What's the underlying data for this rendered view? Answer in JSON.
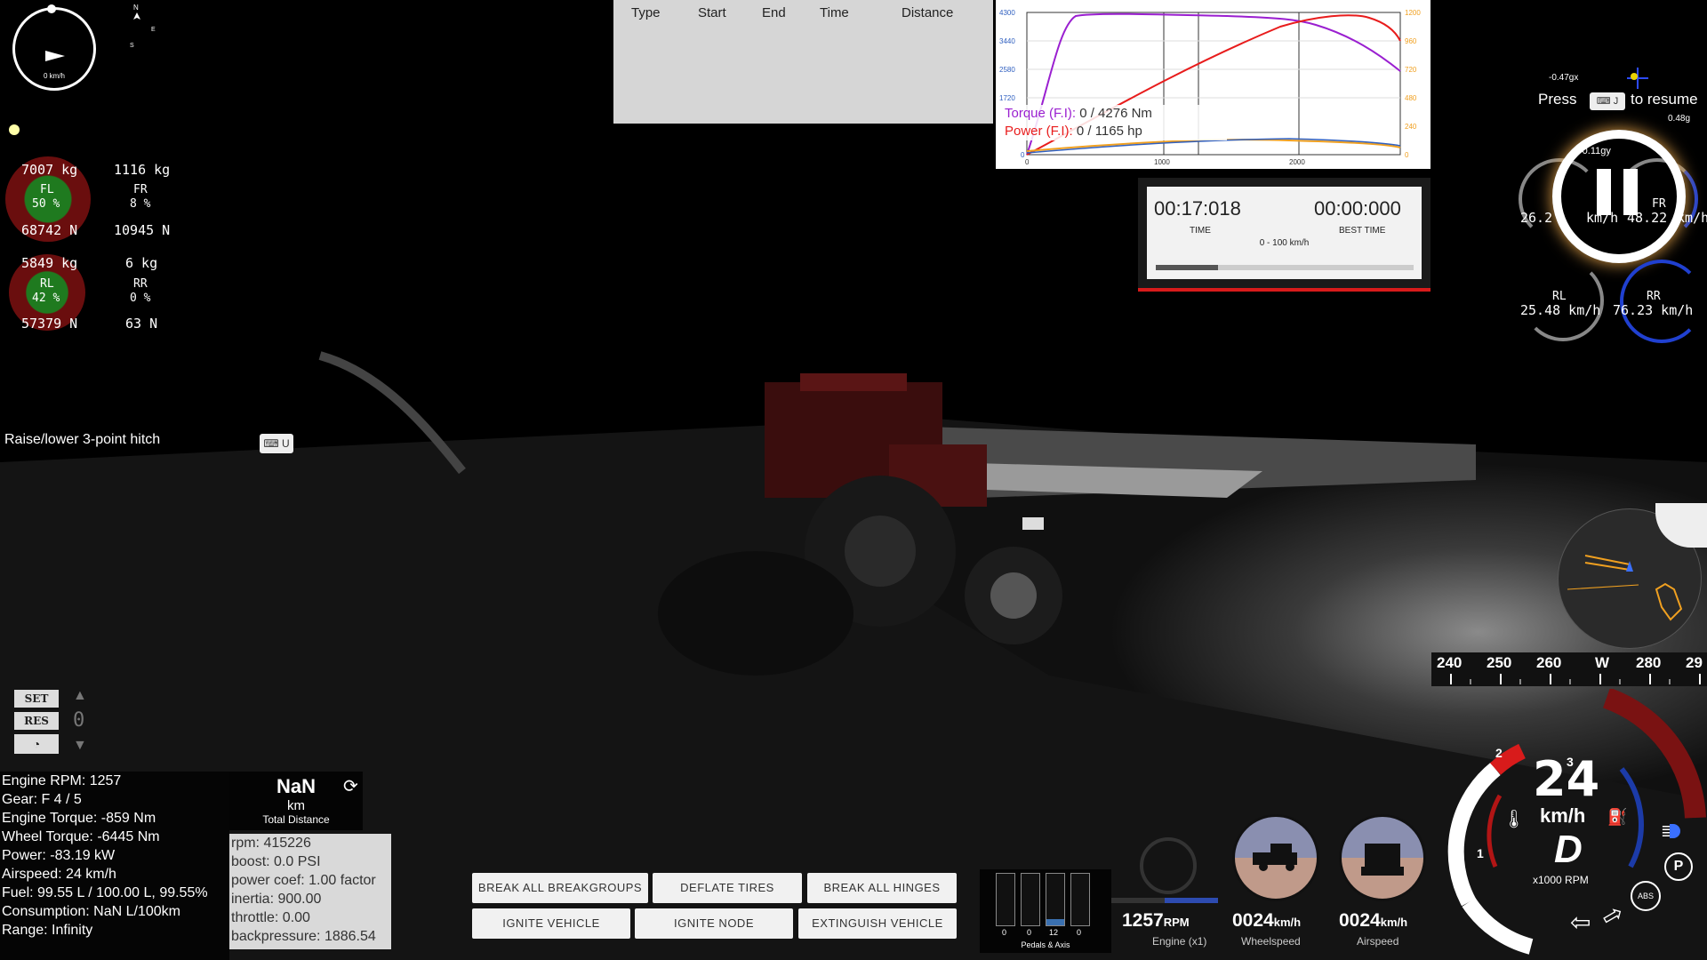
{
  "compass": {
    "speed_text": "0 km/h",
    "small_n": "N",
    "small_s": "S",
    "small_e": "E"
  },
  "wheels": {
    "fl": {
      "weight": "7007 kg",
      "name": "FL",
      "pct": "50 %",
      "force": "68742 N"
    },
    "fr": {
      "weight": "1116 kg",
      "name": "FR",
      "pct": "8 %",
      "force": "10945 N"
    },
    "rl": {
      "weight": "5849 kg",
      "name": "RL",
      "pct": "42 %",
      "force": "57379 N"
    },
    "rr": {
      "weight": "6 kg",
      "name": "RR",
      "pct": "0 %",
      "force": "63 N"
    }
  },
  "hint": {
    "label": "Raise/lower 3-point hitch",
    "key": "U"
  },
  "drag_table": {
    "headers": [
      "Type",
      "Start",
      "End",
      "Time",
      "Distance"
    ]
  },
  "torque_graph": {
    "left_ticks": [
      "4300",
      "3440",
      "2580",
      "1720",
      "0"
    ],
    "right_ticks": [
      "1200",
      "960",
      "720",
      "480",
      "240",
      "0"
    ],
    "x_ticks": [
      "0",
      "1000",
      "2000"
    ],
    "torque_label": "Torque (F.I):",
    "torque_value": "0 / 4276 Nm",
    "power_label": "Power (F.I):",
    "power_value": "0 / 1165 hp",
    "colors": {
      "torque": "#9a1fd0",
      "power": "#e81c1c",
      "blue": "#3060c0",
      "orange": "#f0a020"
    }
  },
  "timer": {
    "time": "00:17:018",
    "time_label": "TIME",
    "best": "00:00:000",
    "best_label": "BEST TIME",
    "mode": "0 - 100 km/h",
    "progress": 0.24
  },
  "pause": {
    "press": "Press",
    "key": "J",
    "resume": "to resume",
    "gx": "-0.47gx",
    "gy": "0.48g",
    "gy2": "-0.11gy"
  },
  "wheel_speeds": {
    "fl": "26.2",
    "fl_unit": "km/h",
    "fr_label": "FR",
    "fr": "48.22",
    "fr_unit": "km/h",
    "rl_label": "RL",
    "rl": "25.48 km/h",
    "rr_label": "RR",
    "rr": "76.23 km/h"
  },
  "cruise": {
    "set": "SET",
    "res": "RES",
    "digit": "0"
  },
  "stats": {
    "rpm": "Engine RPM: 1257",
    "gear": "Gear: F 4 / 5",
    "eng_torque": "Engine Torque: -859 Nm",
    "wheel_torque": "Wheel Torque: -6445 Nm",
    "power": "Power: -83.19 kW",
    "airspeed": "Airspeed: 24 km/h",
    "fuel": "Fuel: 99.55 L / 100.00 L, 99.55%",
    "consumption": "Consumption: NaN L/100km",
    "range": "Range: Infinity"
  },
  "trip": {
    "value": "NaN",
    "unit": "km",
    "label": "Total Distance"
  },
  "engine_panel": {
    "rpm": "rpm: 415226",
    "boost": "boost: 0.0 PSI",
    "power_coef": "power coef: 1.00 factor",
    "inertia": "inertia: 900.00",
    "throttle": "throttle: 0.00",
    "backpressure": "backpressure: 1886.54"
  },
  "buttons": {
    "break_groups": "BREAK ALL BREAKGROUPS",
    "deflate": "DEFLATE TIRES",
    "break_hinges": "BREAK ALL HINGES",
    "ignite_vehicle": "IGNITE VEHICLE",
    "ignite_node": "IGNITE NODE",
    "extinguish": "EXTINGUISH VEHICLE"
  },
  "pedals": {
    "values": [
      "0",
      "0",
      "12",
      "0"
    ],
    "label": "Pedals & Axis",
    "levels": [
      0,
      0,
      0.12,
      0
    ]
  },
  "readouts": {
    "rpm_val": "1257",
    "rpm_unit": "RPM",
    "rpm_label": "Engine (x1)",
    "wheel_val": "0024",
    "wheel_unit": "km/h",
    "wheel_label": "Wheelspeed",
    "air_val": "0024",
    "air_unit": "km/h",
    "air_label": "Airspeed"
  },
  "heading": {
    "ticks": [
      "240",
      "250",
      "260",
      "W",
      "280",
      "29"
    ]
  },
  "speedo": {
    "speed": "24",
    "unit": "km/h",
    "gear": "D",
    "rpm_label": "x1000 RPM",
    "marks": [
      "1",
      "2",
      "3"
    ],
    "abs": "ABS",
    "park": "P"
  }
}
